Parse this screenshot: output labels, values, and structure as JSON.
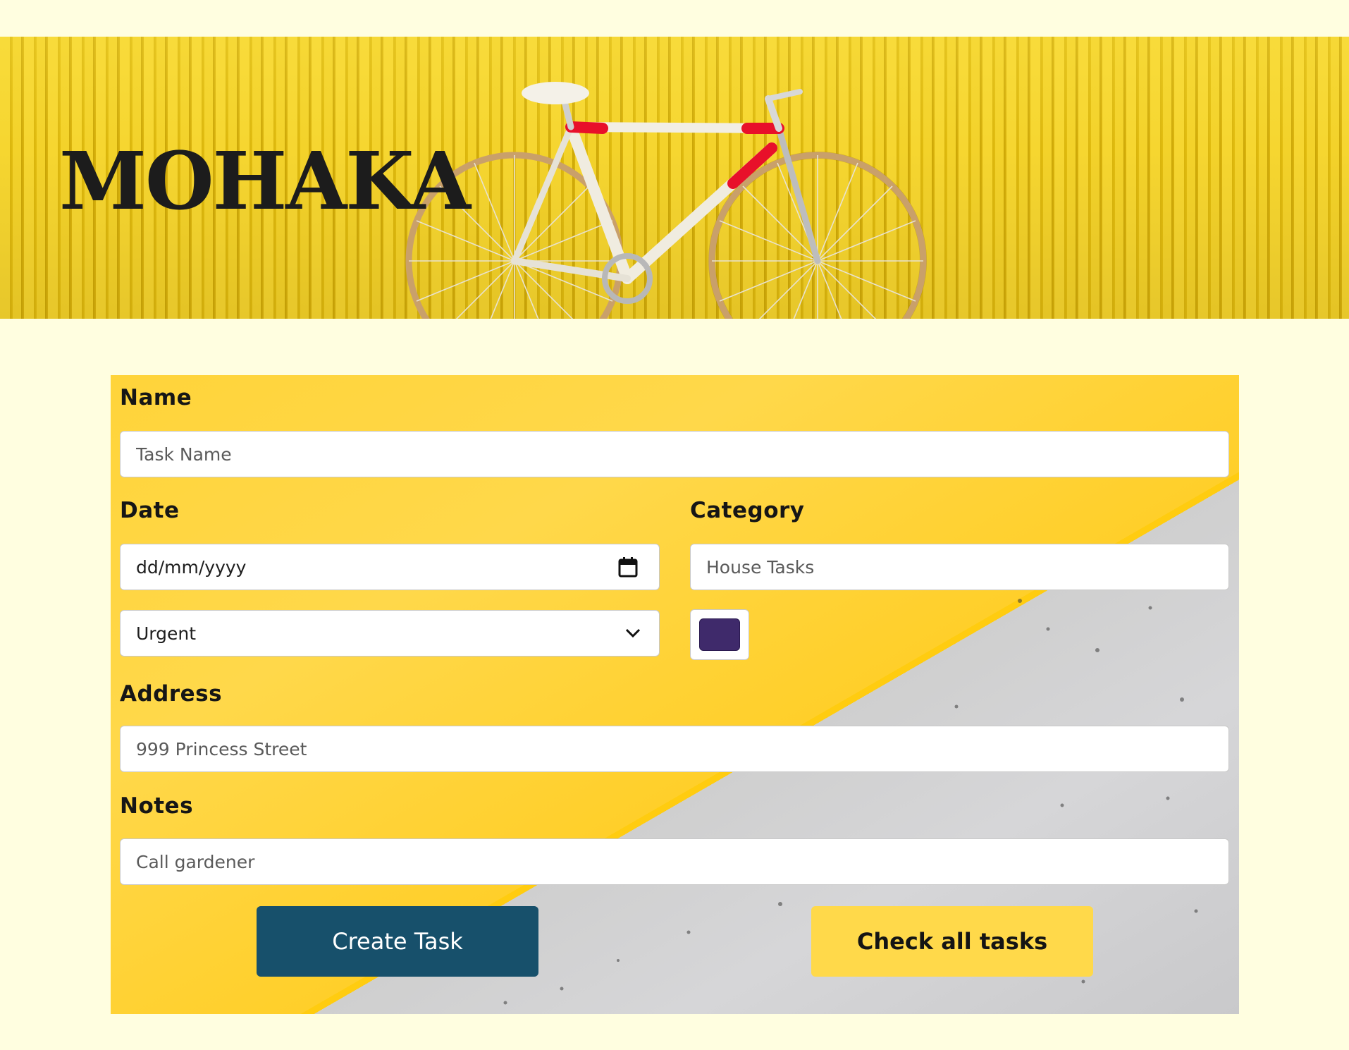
{
  "header": {
    "title": "MOHAKA"
  },
  "form": {
    "name": {
      "label": "Name",
      "placeholder": "Task Name"
    },
    "date": {
      "label": "Date",
      "value": "dd/mm/yyyy"
    },
    "category": {
      "label": "Category",
      "placeholder": "House Tasks"
    },
    "priority": {
      "selected": "Urgent"
    },
    "color": {
      "value": "#3f2a6b"
    },
    "address": {
      "label": "Address",
      "placeholder": "999 Princess Street"
    },
    "notes": {
      "label": "Notes",
      "placeholder": "Call gardener"
    },
    "buttons": {
      "create": "Create Task",
      "check_all": "Check all tasks"
    }
  },
  "colors": {
    "page_background": "#fffee0",
    "primary_button": "#17506b",
    "secondary_button": "#ffd94a",
    "banner_yellow": "#f6d630"
  },
  "icons": {
    "date_picker": "calendar-icon",
    "dropdown": "chevron-down-icon"
  }
}
